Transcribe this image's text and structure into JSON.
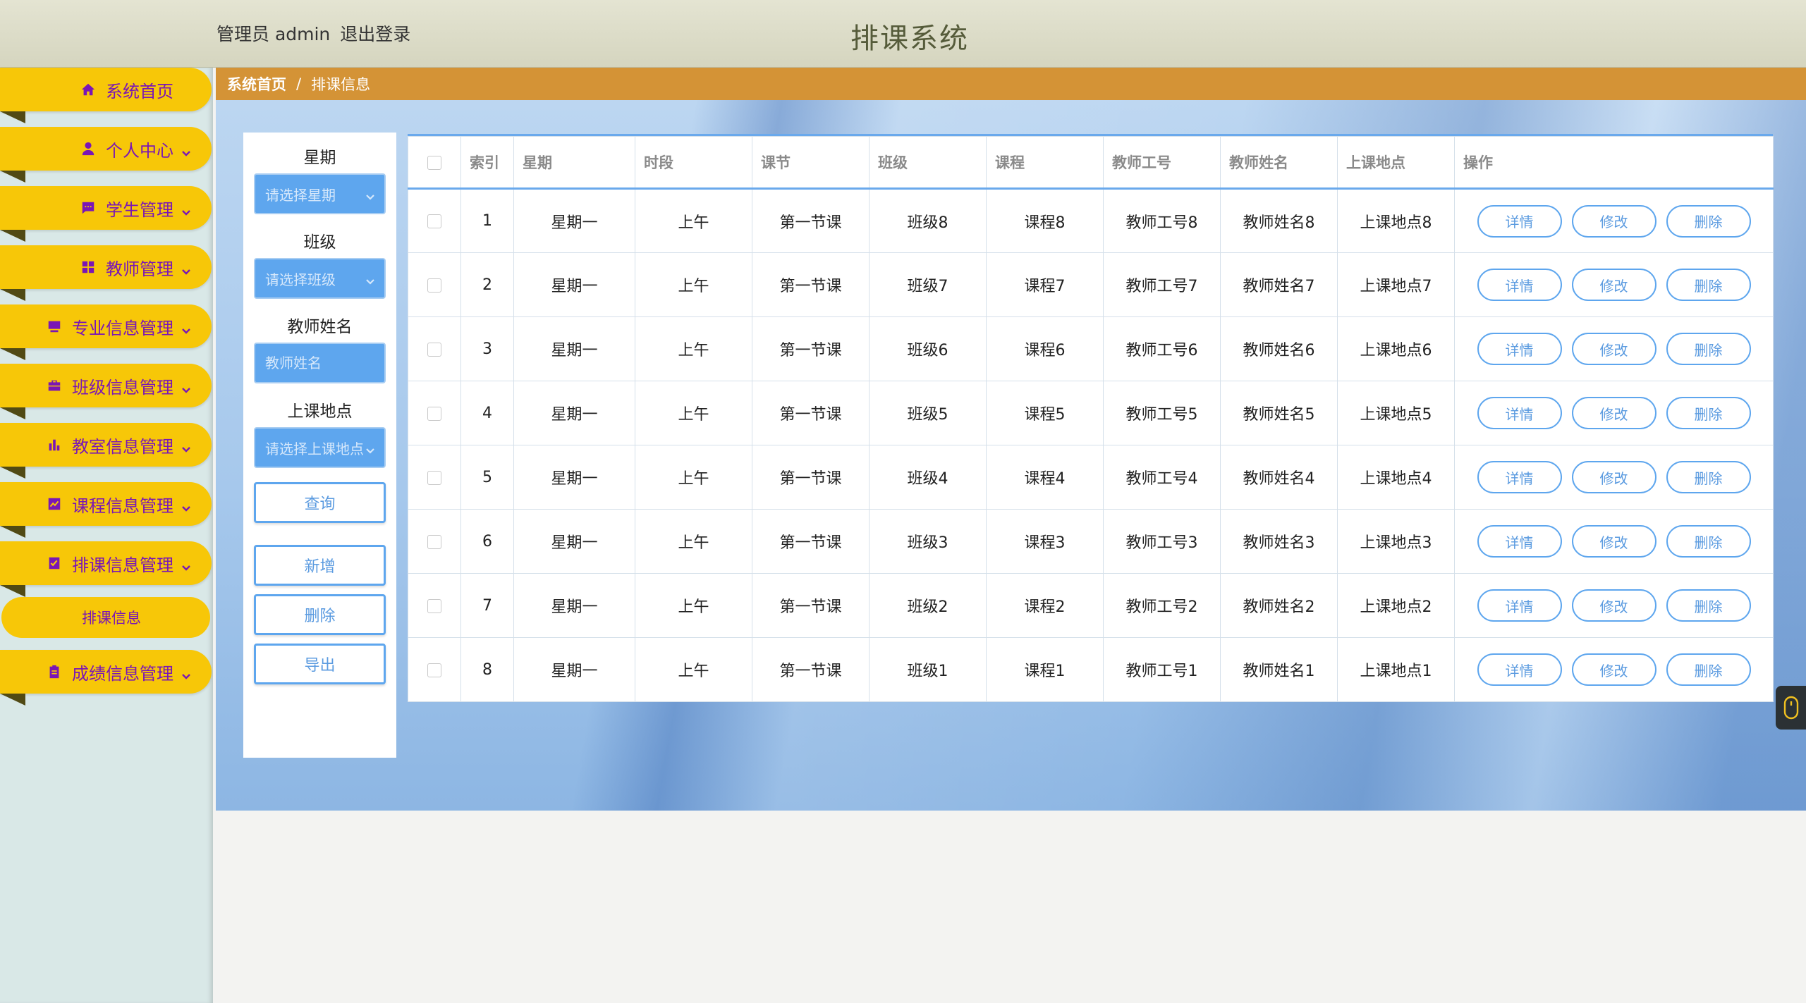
{
  "header": {
    "user_label": "管理员 admin",
    "logout_label": "退出登录",
    "app_title": "排课系统"
  },
  "sidebar": {
    "items": [
      {
        "label": "系统首页",
        "icon": "home-icon",
        "has_children": false
      },
      {
        "label": "个人中心",
        "icon": "user-icon",
        "has_children": true
      },
      {
        "label": "学生管理",
        "icon": "chat-icon",
        "has_children": true
      },
      {
        "label": "教师管理",
        "icon": "grid-icon",
        "has_children": true
      },
      {
        "label": "专业信息管理",
        "icon": "inbox-icon",
        "has_children": true
      },
      {
        "label": "班级信息管理",
        "icon": "briefcase-icon",
        "has_children": true
      },
      {
        "label": "教室信息管理",
        "icon": "bar-chart-icon",
        "has_children": true
      },
      {
        "label": "课程信息管理",
        "icon": "line-chart-icon",
        "has_children": true
      },
      {
        "label": "排课信息管理",
        "icon": "checklist-icon",
        "has_children": true
      },
      {
        "label": "成绩信息管理",
        "icon": "clipboard-icon",
        "has_children": true
      }
    ],
    "active_sub_item": "排课信息"
  },
  "breadcrumb": {
    "home": "系统首页",
    "separator": "/",
    "current": "排课信息"
  },
  "search": {
    "weekday_label": "星期",
    "weekday_placeholder": "请选择星期",
    "class_label": "班级",
    "class_placeholder": "请选择班级",
    "teacher_label": "教师姓名",
    "teacher_placeholder": "教师姓名",
    "location_label": "上课地点",
    "location_placeholder": "请选择上课地点",
    "query_button": "查询",
    "add_button": "新增",
    "delete_button": "删除",
    "export_button": "导出"
  },
  "table": {
    "columns": [
      "索引",
      "星期",
      "时段",
      "课节",
      "班级",
      "课程",
      "教师工号",
      "教师姓名",
      "上课地点",
      "操作"
    ],
    "rows": [
      [
        "1",
        "星期一",
        "上午",
        "第一节课",
        "班级8",
        "课程8",
        "教师工号8",
        "教师姓名8",
        "上课地点8"
      ],
      [
        "2",
        "星期一",
        "上午",
        "第一节课",
        "班级7",
        "课程7",
        "教师工号7",
        "教师姓名7",
        "上课地点7"
      ],
      [
        "3",
        "星期一",
        "上午",
        "第一节课",
        "班级6",
        "课程6",
        "教师工号6",
        "教师姓名6",
        "上课地点6"
      ],
      [
        "4",
        "星期一",
        "上午",
        "第一节课",
        "班级5",
        "课程5",
        "教师工号5",
        "教师姓名5",
        "上课地点5"
      ],
      [
        "5",
        "星期一",
        "上午",
        "第一节课",
        "班级4",
        "课程4",
        "教师工号4",
        "教师姓名4",
        "上课地点4"
      ],
      [
        "6",
        "星期一",
        "上午",
        "第一节课",
        "班级3",
        "课程3",
        "教师工号3",
        "教师姓名3",
        "上课地点3"
      ],
      [
        "7",
        "星期一",
        "上午",
        "第一节课",
        "班级2",
        "课程2",
        "教师工号2",
        "教师姓名2",
        "上课地点2"
      ],
      [
        "8",
        "星期一",
        "上午",
        "第一节课",
        "班级1",
        "课程1",
        "教师工号1",
        "教师姓名1",
        "上课地点1"
      ]
    ],
    "actions": {
      "detail": "详情",
      "edit": "修改",
      "delete": "删除"
    }
  },
  "theme": {
    "sidebar_item_color": "#f7c708",
    "sidebar_text_color": "#7a16b5",
    "breadcrumb_color": "#d49336",
    "accent_blue": "#5ea6ee"
  }
}
